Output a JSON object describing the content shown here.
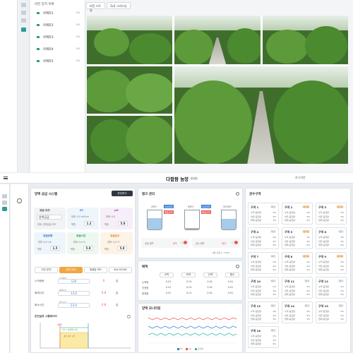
{
  "cctv": {
    "title": "비전 장치 목록",
    "items": [
      {
        "label": "카메라1",
        "status": "ON"
      },
      {
        "label": "카메라2",
        "status": "ON"
      },
      {
        "label": "카메라3",
        "status": "ON"
      },
      {
        "label": "카메라4",
        "status": "ON"
      },
      {
        "label": "카메라5",
        "status": "ON"
      }
    ],
    "view_tabs": [
      "비전 스트림",
      "3x3 그리드뷰"
    ]
  },
  "header": {
    "title": "다함팜 농장",
    "subtitle": "준비중",
    "logout": "로그아웃"
  },
  "nutrient": {
    "title": "양액 공급 시스템",
    "run_button": "운전하기",
    "supply_mode_title": "공급 모드",
    "mode_select": "양액공급",
    "mode_note": "현재: 양액공급 모드",
    "ec": {
      "label": "EC",
      "current": "현재: 0.0 mS/cm",
      "target_label": "목표:",
      "target": "1.2"
    },
    "ph": {
      "label": "pH",
      "current": "현재: 0.0",
      "target_label": "목표:",
      "target": "5.8"
    },
    "supply_amount": {
      "label": "공급유량",
      "current": "현재: 0.0 L/h",
      "target_label": "목표:",
      "target": "1.5"
    },
    "supply_time": {
      "label": "공급시간",
      "current": "현재: 0.0 %",
      "target_label": "목표:",
      "target": "5.8"
    },
    "temperature": {
      "label": "공급온수",
      "current": "현재: 0.0 ℃",
      "target_label": "목표:",
      "target": "5.8"
    },
    "tabs": [
      "이전 운전",
      "운영 운전",
      "재배일 모드",
      "Wiz MODE"
    ],
    "rows": [
      {
        "label": "누적광량",
        "left_caption": "누적광량",
        "left_value": "120",
        "right_value": "0",
        "unit": "분"
      },
      {
        "label": "회래시간",
        "left_caption": "회래시간",
        "left_value": "13.0",
        "right_value": "0.8",
        "unit": "분"
      },
      {
        "label": "회소시간",
        "left_caption": "회소시간",
        "left_value": "23.0",
        "right_value": "0.8",
        "unit": "분"
      }
    ],
    "timeline_title": "운전설정 시뮬레이터",
    "timeline_labels": [
      "배출작",
      "급수 노출(배출시간)",
      "공급 시간 구간"
    ]
  },
  "tanks": {
    "title": "탱크 관리",
    "items": [
      {
        "top": "A탱크",
        "badge1": "공급양대",
        "badge2": "배출양대"
      },
      {
        "top": "B탱크",
        "badge1": "공급양대",
        "badge2": "배출양대"
      },
      {
        "top": "원수탱크",
        "badge1": "",
        "badge2": ""
      }
    ],
    "pump1_label": "공급 펌프",
    "pump1_state": "정지",
    "pump2_label": "급수 펌프",
    "pump2_state": "정지",
    "usage": "사용 인원 수: 225A"
  },
  "irrigation": {
    "title": "배액",
    "headers": [
      "A액",
      "B액",
      "산액",
      "원수"
    ],
    "rows": [
      {
        "label": "누적량",
        "values": [
          "0.01",
          "0.01",
          "0.01",
          "0.01"
        ]
      },
      {
        "label": "이전량",
        "values": [
          "0.01",
          "0.01",
          "0.01",
          "0.01"
        ]
      },
      {
        "label": "현재량",
        "values": [
          "0.01",
          "0.01",
          "0.01",
          "0.01"
        ]
      }
    ]
  },
  "monitor": {
    "title": "양액 모니터링",
    "legend": [
      "EC",
      "pH",
      "공급량"
    ]
  },
  "zones": {
    "title": "관수구역",
    "row_labels": [
      "누적 공급량",
      "이전 공급량",
      "현재 공급량"
    ],
    "items": [
      {
        "name": "구역 1",
        "badge": "대기",
        "vals": [
          "1%",
          "1%",
          "1%"
        ]
      },
      {
        "name": "구역 2",
        "badge": "동작중",
        "vals": [
          "1%",
          "1%",
          "1%"
        ]
      },
      {
        "name": "구역 3",
        "badge": "동작중",
        "vals": [
          "1%",
          "1%",
          "1%"
        ]
      },
      {
        "name": "구역 4",
        "badge": "대기",
        "vals": [
          "1%",
          "1%",
          "1%"
        ]
      },
      {
        "name": "구역 5",
        "badge": "동작중",
        "vals": [
          "1%",
          "1%",
          "1%"
        ]
      },
      {
        "name": "구역 6",
        "badge": "대기",
        "vals": [
          "1%",
          "1%",
          "1%"
        ]
      },
      {
        "name": "구역 7",
        "badge": "대기",
        "vals": [
          "1%",
          "1%",
          "1%"
        ]
      },
      {
        "name": "구역 8",
        "badge": "동작중",
        "vals": [
          "1%",
          "1%",
          "1%"
        ]
      },
      {
        "name": "구역 9",
        "badge": "동작중",
        "vals": [
          "1%",
          "1%",
          "1%"
        ]
      },
      {
        "name": "구역 10",
        "badge": "대기",
        "vals": [
          "1%",
          "1%",
          "1%"
        ]
      },
      {
        "name": "구역 11",
        "badge": "대기",
        "vals": [
          "1%",
          "1%",
          "1%"
        ]
      },
      {
        "name": "구역 12",
        "badge": "대기",
        "vals": [
          "1%",
          "1%",
          "1%"
        ]
      },
      {
        "name": "구역 13",
        "badge": "대기",
        "vals": [
          "1%",
          "1%",
          "1%"
        ]
      },
      {
        "name": "구역 14",
        "badge": "대기",
        "vals": [
          "1%",
          "1%",
          "1%"
        ]
      },
      {
        "name": "구역 15",
        "badge": "대기",
        "vals": [
          "1%",
          "1%",
          "1%"
        ]
      },
      {
        "name": "구역 16",
        "badge": "대기",
        "vals": [
          "1%",
          "1%",
          "1%"
        ]
      }
    ]
  },
  "colors": {
    "accent": "#2c9c95",
    "active": "#f1a640",
    "danger": "#e85a4f"
  }
}
